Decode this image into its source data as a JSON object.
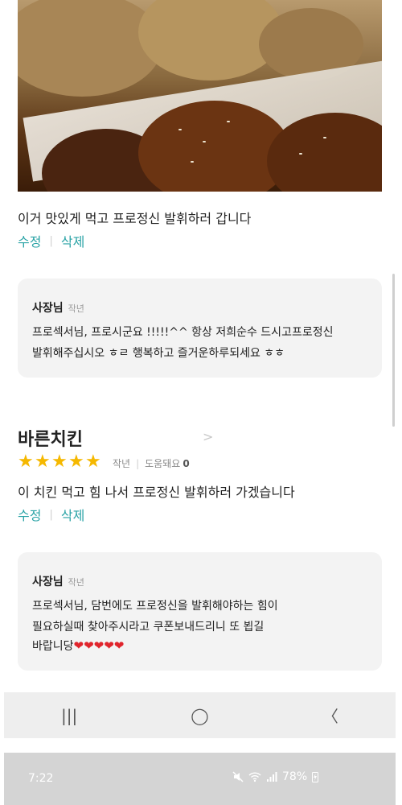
{
  "review1": {
    "text": "이거 맛있게 먹고 프로정신 발휘하러 갑니다",
    "edit": "수정",
    "delete": "삭제",
    "reply": {
      "owner": "사장님",
      "when": "작년",
      "lines": [
        "프로섹서님, 프로시군요 !!!!!^^ 항상 저희순수 드시고프로정신",
        "발휘해주십시오 ㅎㄹ 행복하고 즐거운하루되세요 ㅎㅎ"
      ]
    }
  },
  "review2": {
    "store": "바른치킨",
    "rating": 5,
    "stars": [
      "★",
      "★",
      "★",
      "★",
      "★"
    ],
    "when": "작년",
    "helpful_label": "도움돼요",
    "helpful_count": "0",
    "text": "이 치킨 먹고 힘 나서 프로정신 발휘하러 가겠습니다",
    "edit": "수정",
    "delete": "삭제",
    "reply": {
      "owner": "사장님",
      "when": "작년",
      "lines": [
        "프로섹서님, 담번에도 프로정신을 발휘해야하는 힘이",
        "필요하실때 찾아주시라고 쿠폰보내드리니 또 뵙길",
        "바랍니당"
      ],
      "hearts": "❤❤❤❤❤"
    }
  },
  "navbar": {
    "recents": "|||",
    "home": "◯",
    "back": "〈"
  },
  "statusbar": {
    "time": "7:22",
    "battery": "78%"
  },
  "colors": {
    "accent": "#2aa3a6",
    "star": "#f5b800",
    "heart": "#e0242c"
  }
}
